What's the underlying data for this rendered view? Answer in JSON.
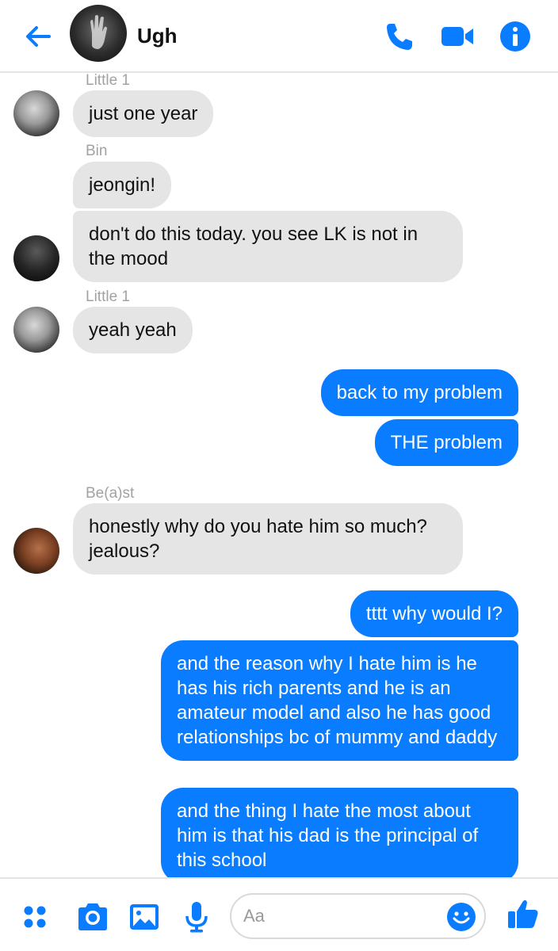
{
  "header": {
    "title": "Ugh",
    "accent_color": "#0a7cff",
    "icons": [
      "back-arrow-icon",
      "phone-icon",
      "video-camera-icon",
      "info-icon"
    ]
  },
  "messages": [
    {
      "sender": "Little 1",
      "text": "just one year",
      "direction": "incoming"
    },
    {
      "sender": "Bin",
      "text": "jeongin!",
      "direction": "incoming"
    },
    {
      "text": "don't do this today. you see LK is not in the mood",
      "direction": "incoming"
    },
    {
      "sender": "Little 1",
      "text": "yeah yeah",
      "direction": "incoming"
    },
    {
      "text": "back to my problem",
      "direction": "outgoing"
    },
    {
      "text": "THE problem",
      "direction": "outgoing"
    },
    {
      "sender": "Be(a)st",
      "text": "honestly why do you hate him so much? jealous?",
      "direction": "incoming"
    },
    {
      "text": "tttt why would I?",
      "direction": "outgoing"
    },
    {
      "text": "and the reason why I hate him is he has his rich parents and he is an amateur model and also he has good relationships bc of mummy and daddy",
      "direction": "outgoing"
    },
    {
      "text": "and the thing I hate the most about him is that his dad is the principal of this school",
      "direction": "outgoing"
    }
  ],
  "composer": {
    "placeholder": "Aa",
    "value": "",
    "icons": [
      "menu-dots-icon",
      "camera-icon",
      "gallery-icon",
      "microphone-icon",
      "emoji-icon",
      "thumbs-up-icon"
    ]
  }
}
